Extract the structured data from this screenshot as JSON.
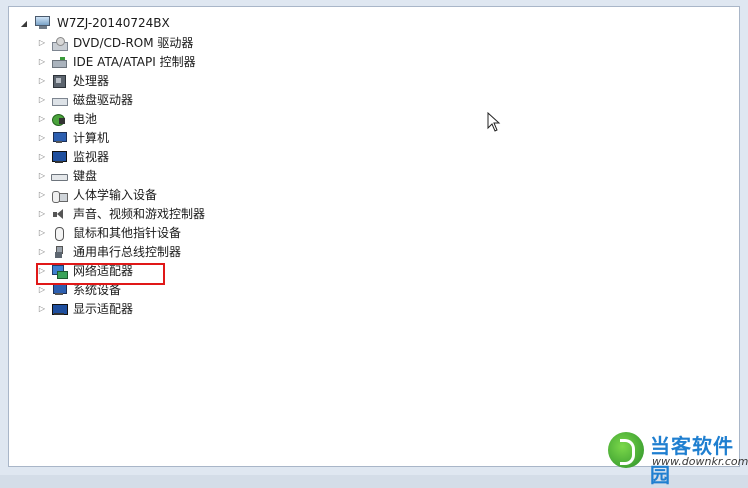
{
  "root": {
    "label": "W7ZJ-20140724BX",
    "icon": "computer-icon"
  },
  "devices": [
    {
      "label": "DVD/CD-ROM 驱动器",
      "icon": "dvd-drive-icon"
    },
    {
      "label": "IDE ATA/ATAPI 控制器",
      "icon": "ide-controller-icon"
    },
    {
      "label": "处理器",
      "icon": "processor-icon"
    },
    {
      "label": "磁盘驱动器",
      "icon": "disk-drive-icon"
    },
    {
      "label": "电池",
      "icon": "battery-icon"
    },
    {
      "label": "计算机",
      "icon": "computer-icon"
    },
    {
      "label": "监视器",
      "icon": "monitor-icon"
    },
    {
      "label": "键盘",
      "icon": "keyboard-icon"
    },
    {
      "label": "人体学输入设备",
      "icon": "hid-icon"
    },
    {
      "label": "声音、视频和游戏控制器",
      "icon": "speaker-icon"
    },
    {
      "label": "鼠标和其他指针设备",
      "icon": "mouse-icon"
    },
    {
      "label": "通用串行总线控制器",
      "icon": "usb-icon"
    },
    {
      "label": "网络适配器",
      "icon": "network-adapter-icon"
    },
    {
      "label": "系统设备",
      "icon": "system-device-icon"
    },
    {
      "label": "显示适配器",
      "icon": "display-adapter-icon"
    }
  ],
  "highlight_color": "#e01818",
  "watermark": {
    "name": "当客软件园",
    "url": "www.downkr.com"
  }
}
